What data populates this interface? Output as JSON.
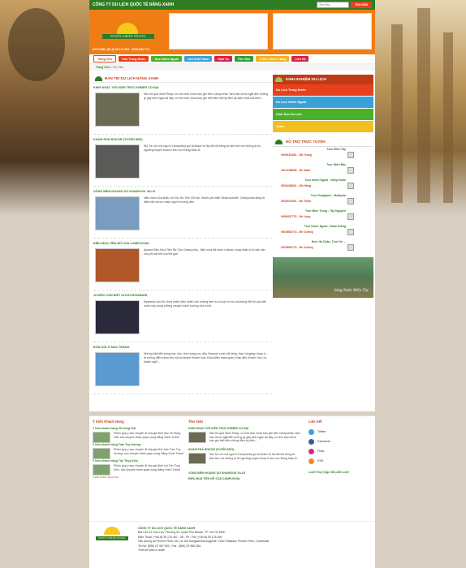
{
  "topbar": {
    "company": "CÔNG TY DU LỊCH QUỐC TẾ NẮNG XANH",
    "search_placeholder": "Tìm Ken...",
    "search_button": "TÌM KIẾM"
  },
  "logo": {
    "brand": "SUNNY GREEN TRAVEL",
    "slogan": "HOTLINE: (84-8) 35 176 467 - 0919 852 774"
  },
  "nav": [
    {
      "label": "Trang Chủ",
      "color": "#ffffff",
      "text": "#c7431c"
    },
    {
      "label": "Tour Trong Nước",
      "color": "#e8411d"
    },
    {
      "label": "Tour Nước Ngoài",
      "color": "#4caf2a"
    },
    {
      "label": "Lịch Khởi Hành",
      "color": "#3aa0d8"
    },
    {
      "label": "Dịch Vụ",
      "color": "#d8204a"
    },
    {
      "label": "Thư Viện",
      "color": "#2f9e3a"
    },
    {
      "label": "Ý Kiến Khách Hàng",
      "color": "#f0b020"
    },
    {
      "label": "Liên Hệ",
      "color": "#d8204a"
    }
  ],
  "breadcrumb": {
    "home": "Trang Chủ",
    "current": "Thư Viện"
  },
  "news_section": {
    "title": "BẢN TIN DU LỊCH NẮNG XANH"
  },
  "news": [
    {
      "title": "KINH NGẠC VỚI KIẾN TRÚC KHMER CỔ ĐẠI",
      "text": "Nếu bề qua Siem Reap, có như bạn chưa bao giờ đến Campuchia. Nếu bạn chưa ngắt đến những gì gây kinh ngạc tại đây, có như bạn chưa bao giờ biết đến những điều kỳ diệu nhất của kiến...",
      "img": "#6b6a52"
    },
    {
      "title": "KHÁM PHÁ BOKOR (TUYẾN MỚI)",
      "text": "Núi Tà Lơn mà người Campuchia gọi là Bokor từ lâu đã nổi tiếng về tâm linh với những ai tin ngưỡng huyền thoại ở khu vực Đông Nam Á.",
      "img": "#5a5a58"
    },
    {
      "title": "VÒNG BIỂN HOANG SƠ KHAMOOK VILLE",
      "text": "Nằm cách cửa khẩu Xà Xía, Hà Tiên 150 km, thành phố biển Sihianoukville, Campuchia đang là điểm đến được nhiều người hướng đến.",
      "img": "#7a9cc0"
    },
    {
      "title": "ĐIỆU MÚA TIÊN NỮ CỦA CAMPUCHIA",
      "text": "Apsara Điệu Múa Tiên Nữ Của Campuchia - điệu múa đã được Unesco công nhận là Di sản văn hóa phi vật thể của thế giới",
      "img": "#b0582a"
    },
    {
      "title": "10 ĐIỀU CẦN BIẾT KHI ĐI MYANMAR",
      "text": "Myanmar còn ẩn chứa nhiều điều khiến cho những ftee du hi luôn tò mò và không thể bỏ qua đất nước này trong những chuyến hành hướng của mình.",
      "img": "#2a2a3a"
    },
    {
      "title": "ĐÓN GIÓ Ở NHA TRANG",
      "text": "Những bãi biển trong veo, khu vinh hoang sơ, đảo Vinpearl Land nổi tiếng, thác Yangbay hùng vĩ... là những điểm nhấn thu hút du khách Khánh Hòa. Đưa điểm tham quan Khác đến Khánh Hòa, du khách nghỉ...",
      "img": "#5a9ad0"
    }
  ],
  "experience": {
    "title": "KINH NGHIỆM DU LỊCH",
    "items": [
      {
        "label": "Du Lịch Trong Nước",
        "color": "#e8411d"
      },
      {
        "label": "Du Lịch Nước Ngoài",
        "color": "#3aa0d8"
      },
      {
        "label": "Hình Ảnh Du Lịch",
        "color": "#4caf2a"
      },
      {
        "label": "Video",
        "color": "#f0c020"
      }
    ]
  },
  "support": {
    "title": "HỖ TRỢ TRỰC TUYẾN",
    "items": [
      {
        "group": "Tour Miền Tây",
        "phone": "0908161661 - Ms Trang"
      },
      {
        "group": "Tour Miền Bắc",
        "phone": "0912788539 - Mr Xuân"
      },
      {
        "group": "Tour Nước Ngoài - Ghép Đoàn",
        "phone": "0933438831 - Ms Hằng"
      },
      {
        "group": "Tour Singapore - Malaysia",
        "phone": "0932610091 - Mr Thịnh"
      },
      {
        "group": "Tour Miền Trung - Tây Nguyên",
        "phone": "0908437770 - Mr Long"
      },
      {
        "group": "Tour Nước Ngoài - Đoàn Riêng",
        "phone": "0919852774 - Mr Cường"
      },
      {
        "group": "Hue, Hà Châu, Thuê Xe ...",
        "phone": "0919852774 - Mr Cường"
      }
    ]
  },
  "photo_caption": "Sông Nước Miền Tây",
  "testimonials": {
    "title": "Ý Kiến Khách Hàng",
    "items": [
      {
        "name": "Ý kiến khách hàng Võ Hùng Việt",
        "text": "Phiều góp ý sau chuyến đi của gia đình bác Võ Hùng Việt, sau chuyến tham quan cùng Nắng Xanh Travel"
      },
      {
        "name": "Ý kiến khách hàng Trần Tùy Hương",
        "text": "Phiều góp ý sau chuyến đi của gia đình bác Trần Tùy Hương, sau chuyến tham quan cùng Nắng Xanh Travel"
      },
      {
        "name": "Ý kiến khách hàng Tôn Thụy Kiều",
        "text": "Phiều góp ý sau chuyến đi của gia đình chị Tôn Thụy Kiều, sau chuyến tham quan cùng Nắng Xanh Travel"
      }
    ],
    "more": "Ý kiến khách hàng khác"
  },
  "library": {
    "title": "Thư Viện",
    "items": [
      {
        "name": "KINH NGẠC VỚI KIẾN TRÚC KHMER CỔ ĐẠI",
        "text": "Nếu bề qua Siem Reap, có như bạn chưa bao giờ đến Campuchia. Nếu bạn chưa ngắt đến những gì gây kinh ngạc tại đây, có như bạn chưa bao giờ biết đến những điều kỳ diệu..."
      },
      {
        "name": "KHÁM PHÁ BOKOR (TUYẾN MỚI)",
        "text": "Núi Tà Lơn mà người Campuchia gọi là Bokor từ lâu đã nổi tiếng về tâm linh với những ai tin ngưỡng huyền thoại ở khu vực Đông Nam Á."
      }
    ],
    "links": [
      "VÒNG BIỂN HOANG SƠ KHAMOOK VILLE",
      "ĐIỆU MÚA TIÊN NỮ CỦA CAMPUCHIA"
    ]
  },
  "links": {
    "title": "Liên Kết",
    "items": [
      {
        "label": "Twitter",
        "color": "#3aa0d8"
      },
      {
        "label": "Facebook",
        "color": "#3b5998"
      },
      {
        "label": "Flickr",
        "color": "#e0208a"
      },
      {
        "label": "RSS",
        "color": "#f08a20"
      }
    ],
    "visits": "Lượt Truy Cập: 663,235 Lượt"
  },
  "footer": {
    "company": "CÔNG TY DU LỊCH QUỐC TẾ NẮNG XANH",
    "address": "Địa Chỉ: 91 Hoa Lan, Phường 02, Quận Phú Nhuận, TP. Hồ Chí Minh",
    "phone": "Điện Thoại: (+84-8) 35 176 467 - 08 - 09 - Fax: (+84-8) 35 176 496",
    "office": "Văn phòng tại Phnôm Pênh: #10, st 105 Sangkat Boeungprolit, Khan 7Makara, Phnom Penh, Cambodia",
    "tel": "Tel No: (855) 23 357 969 , Fax : (855) 23 986 354.",
    "design": "Thiết kế Web iCreate"
  }
}
